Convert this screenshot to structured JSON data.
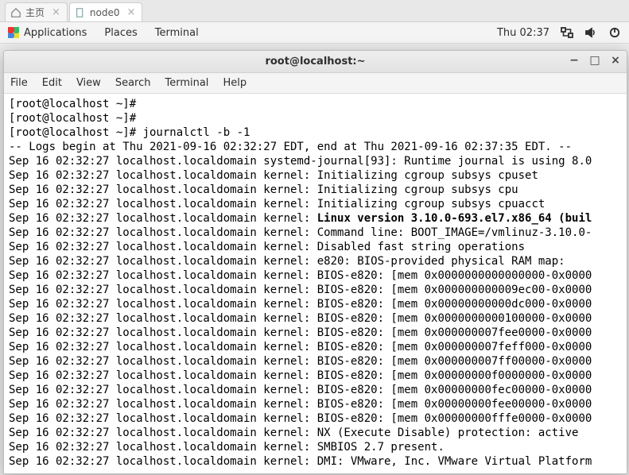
{
  "outer_tabs": [
    {
      "label": "主页",
      "icon": "home",
      "active": false
    },
    {
      "label": "node0",
      "icon": "file",
      "active": true
    }
  ],
  "panel": {
    "applications": "Applications",
    "places": "Places",
    "terminal": "Terminal",
    "clock": "Thu 02:37"
  },
  "window": {
    "title": "root@localhost:~",
    "menubar": [
      "File",
      "Edit",
      "View",
      "Search",
      "Terminal",
      "Help"
    ],
    "controls": {
      "min": "−",
      "max": "□",
      "close": "×"
    }
  },
  "terminal_lines": [
    {
      "text": "[root@localhost ~]# "
    },
    {
      "text": "[root@localhost ~]# "
    },
    {
      "text": "[root@localhost ~]# journalctl -b -1"
    },
    {
      "text": "-- Logs begin at Thu 2021-09-16 02:32:27 EDT, end at Thu 2021-09-16 02:37:35 EDT. --"
    },
    {
      "text": "Sep 16 02:32:27 localhost.localdomain systemd-journal[93]: Runtime journal is using 8.0"
    },
    {
      "text": "Sep 16 02:32:27 localhost.localdomain kernel: Initializing cgroup subsys cpuset"
    },
    {
      "text": "Sep 16 02:32:27 localhost.localdomain kernel: Initializing cgroup subsys cpu"
    },
    {
      "text": "Sep 16 02:32:27 localhost.localdomain kernel: Initializing cgroup subsys cpuacct"
    },
    {
      "prefix": "Sep 16 02:32:27 localhost.localdomain kernel: ",
      "bold": "Linux version 3.10.0-693.el7.x86_64 (buil"
    },
    {
      "text": "Sep 16 02:32:27 localhost.localdomain kernel: Command line: BOOT_IMAGE=/vmlinuz-3.10.0-"
    },
    {
      "text": "Sep 16 02:32:27 localhost.localdomain kernel: Disabled fast string operations"
    },
    {
      "text": "Sep 16 02:32:27 localhost.localdomain kernel: e820: BIOS-provided physical RAM map:"
    },
    {
      "text": "Sep 16 02:32:27 localhost.localdomain kernel: BIOS-e820: [mem 0x0000000000000000-0x0000"
    },
    {
      "text": "Sep 16 02:32:27 localhost.localdomain kernel: BIOS-e820: [mem 0x000000000009ec00-0x0000"
    },
    {
      "text": "Sep 16 02:32:27 localhost.localdomain kernel: BIOS-e820: [mem 0x00000000000dc000-0x0000"
    },
    {
      "text": "Sep 16 02:32:27 localhost.localdomain kernel: BIOS-e820: [mem 0x0000000000100000-0x0000"
    },
    {
      "text": "Sep 16 02:32:27 localhost.localdomain kernel: BIOS-e820: [mem 0x000000007fee0000-0x0000"
    },
    {
      "text": "Sep 16 02:32:27 localhost.localdomain kernel: BIOS-e820: [mem 0x000000007feff000-0x0000"
    },
    {
      "text": "Sep 16 02:32:27 localhost.localdomain kernel: BIOS-e820: [mem 0x000000007ff00000-0x0000"
    },
    {
      "text": "Sep 16 02:32:27 localhost.localdomain kernel: BIOS-e820: [mem 0x00000000f0000000-0x0000"
    },
    {
      "text": "Sep 16 02:32:27 localhost.localdomain kernel: BIOS-e820: [mem 0x00000000fec00000-0x0000"
    },
    {
      "text": "Sep 16 02:32:27 localhost.localdomain kernel: BIOS-e820: [mem 0x00000000fee00000-0x0000"
    },
    {
      "text": "Sep 16 02:32:27 localhost.localdomain kernel: BIOS-e820: [mem 0x00000000fffe0000-0x0000"
    },
    {
      "text": "Sep 16 02:32:27 localhost.localdomain kernel: NX (Execute Disable) protection: active"
    },
    {
      "text": "Sep 16 02:32:27 localhost.localdomain kernel: SMBIOS 2.7 present."
    },
    {
      "text": "Sep 16 02:32:27 localhost.localdomain kernel: DMI: VMware, Inc. VMware Virtual Platform"
    }
  ],
  "icons": {
    "home": "⌂",
    "file": "📄"
  }
}
